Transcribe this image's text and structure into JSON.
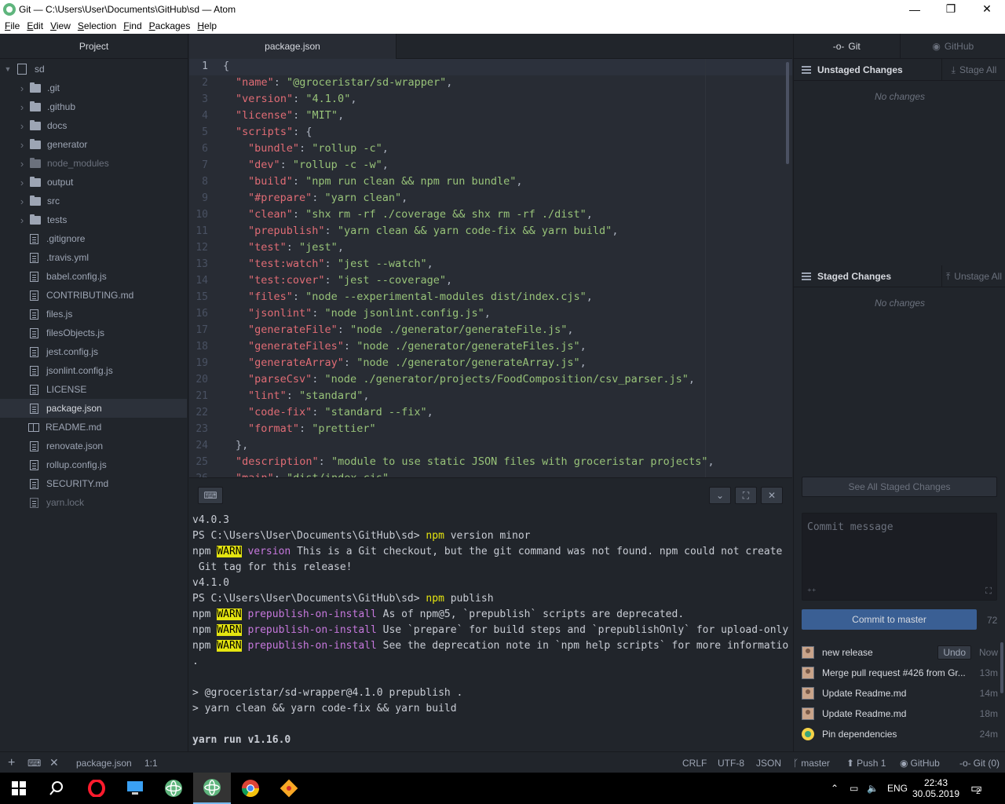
{
  "window": {
    "title": "Git — C:\\Users\\User\\Documents\\GitHub\\sd — Atom",
    "controls": [
      "—",
      "❐",
      "✕"
    ]
  },
  "menu": [
    {
      "u": "F",
      "rest": "ile"
    },
    {
      "u": "E",
      "rest": "dit"
    },
    {
      "u": "V",
      "rest": "iew"
    },
    {
      "u": "S",
      "rest": "election"
    },
    {
      "u": "F",
      "rest": "ind"
    },
    {
      "u": "P",
      "rest": "ackages"
    },
    {
      "u": "H",
      "rest": "elp"
    }
  ],
  "tree": {
    "title": "Project",
    "root": "sd",
    "items": [
      {
        "name": ".git",
        "type": "folder",
        "ignored": false
      },
      {
        "name": ".github",
        "type": "folder",
        "ignored": false
      },
      {
        "name": "docs",
        "type": "folder",
        "ignored": false
      },
      {
        "name": "generator",
        "type": "folder",
        "ignored": false
      },
      {
        "name": "node_modules",
        "type": "folder",
        "ignored": true
      },
      {
        "name": "output",
        "type": "folder",
        "ignored": false
      },
      {
        "name": "src",
        "type": "folder",
        "ignored": false
      },
      {
        "name": "tests",
        "type": "folder",
        "ignored": false
      },
      {
        "name": ".gitignore",
        "type": "file",
        "ignored": false
      },
      {
        "name": ".travis.yml",
        "type": "file",
        "ignored": false
      },
      {
        "name": "babel.config.js",
        "type": "file",
        "ignored": false
      },
      {
        "name": "CONTRIBUTING.md",
        "type": "file",
        "ignored": false
      },
      {
        "name": "files.js",
        "type": "file",
        "ignored": false
      },
      {
        "name": "filesObjects.js",
        "type": "file",
        "ignored": false
      },
      {
        "name": "jest.config.js",
        "type": "file",
        "ignored": false
      },
      {
        "name": "jsonlint.config.js",
        "type": "file",
        "ignored": false
      },
      {
        "name": "LICENSE",
        "type": "file",
        "ignored": false
      },
      {
        "name": "package.json",
        "type": "file",
        "ignored": false,
        "selected": true
      },
      {
        "name": "README.md",
        "type": "book",
        "ignored": false
      },
      {
        "name": "renovate.json",
        "type": "file",
        "ignored": false
      },
      {
        "name": "rollup.config.js",
        "type": "file",
        "ignored": false
      },
      {
        "name": "SECURITY.md",
        "type": "file",
        "ignored": false
      },
      {
        "name": "yarn.lock",
        "type": "file",
        "ignored": true
      }
    ]
  },
  "editor": {
    "tab": "package.json",
    "lines": [
      {
        "n": "1",
        "indent": 0,
        "text": "{"
      },
      {
        "n": "2",
        "indent": 1,
        "key": "\"name\"",
        "val": "\"@groceristar/sd-wrapper\"",
        "tail": ","
      },
      {
        "n": "3",
        "indent": 1,
        "key": "\"version\"",
        "val": "\"4.1.0\"",
        "tail": ","
      },
      {
        "n": "4",
        "indent": 1,
        "key": "\"license\"",
        "val": "\"MIT\"",
        "tail": ","
      },
      {
        "n": "5",
        "indent": 1,
        "key": "\"scripts\"",
        "val": "",
        "tail": " {"
      },
      {
        "n": "6",
        "indent": 2,
        "key": "\"bundle\"",
        "val": "\"rollup -c\"",
        "tail": ","
      },
      {
        "n": "7",
        "indent": 2,
        "key": "\"dev\"",
        "val": "\"rollup -c -w\"",
        "tail": ","
      },
      {
        "n": "8",
        "indent": 2,
        "key": "\"build\"",
        "val": "\"npm run clean && npm run bundle\"",
        "tail": ","
      },
      {
        "n": "9",
        "indent": 2,
        "key": "\"#prepare\"",
        "val": "\"yarn clean\"",
        "tail": ","
      },
      {
        "n": "10",
        "indent": 2,
        "key": "\"clean\"",
        "val": "\"shx rm -rf ./coverage && shx rm -rf ./dist\"",
        "tail": ","
      },
      {
        "n": "11",
        "indent": 2,
        "key": "\"prepublish\"",
        "val": "\"yarn clean && yarn code-fix && yarn build\"",
        "tail": ","
      },
      {
        "n": "12",
        "indent": 2,
        "key": "\"test\"",
        "val": "\"jest\"",
        "tail": ","
      },
      {
        "n": "13",
        "indent": 2,
        "key": "\"test:watch\"",
        "val": "\"jest --watch\"",
        "tail": ","
      },
      {
        "n": "14",
        "indent": 2,
        "key": "\"test:cover\"",
        "val": "\"jest --coverage\"",
        "tail": ","
      },
      {
        "n": "15",
        "indent": 2,
        "key": "\"files\"",
        "val": "\"node --experimental-modules dist/index.cjs\"",
        "tail": ","
      },
      {
        "n": "16",
        "indent": 2,
        "key": "\"jsonlint\"",
        "val": "\"node jsonlint.config.js\"",
        "tail": ","
      },
      {
        "n": "17",
        "indent": 2,
        "key": "\"generateFile\"",
        "val": "\"node ./generator/generateFile.js\"",
        "tail": ","
      },
      {
        "n": "18",
        "indent": 2,
        "key": "\"generateFiles\"",
        "val": "\"node ./generator/generateFiles.js\"",
        "tail": ","
      },
      {
        "n": "19",
        "indent": 2,
        "key": "\"generateArray\"",
        "val": "\"node ./generator/generateArray.js\"",
        "tail": ","
      },
      {
        "n": "20",
        "indent": 2,
        "key": "\"parseCsv\"",
        "val": "\"node ./generator/projects/FoodComposition/csv_parser.js\"",
        "tail": ","
      },
      {
        "n": "21",
        "indent": 2,
        "key": "\"lint\"",
        "val": "\"standard\"",
        "tail": ","
      },
      {
        "n": "22",
        "indent": 2,
        "key": "\"code-fix\"",
        "val": "\"standard --fix\"",
        "tail": ","
      },
      {
        "n": "23",
        "indent": 2,
        "key": "\"format\"",
        "val": "\"prettier\"",
        "tail": ""
      },
      {
        "n": "24",
        "indent": 1,
        "text": "},"
      },
      {
        "n": "25",
        "indent": 1,
        "key": "\"description\"",
        "val": "\"module to use static JSON files with groceristar projects\"",
        "tail": ","
      },
      {
        "n": "26",
        "indent": 1,
        "key": "\"main\"",
        "val": "\"dist/index.cjs\"",
        "tail": ","
      }
    ]
  },
  "terminal": {
    "lines": [
      [
        {
          "t": "v4.0.3"
        }
      ],
      [
        {
          "t": "PS C:\\Users\\User\\Documents\\GitHub\\sd> "
        },
        {
          "t": "npm",
          "c": "cmd"
        },
        {
          "t": " version minor"
        }
      ],
      [
        {
          "t": "npm "
        },
        {
          "t": "WARN",
          "c": "warn"
        },
        {
          "t": " "
        },
        {
          "t": "version",
          "c": "mag"
        },
        {
          "t": " This is a Git checkout, but the git command was not found. npm could not create a"
        }
      ],
      [
        {
          "t": " Git tag for this release!"
        }
      ],
      [
        {
          "t": "v4.1.0"
        }
      ],
      [
        {
          "t": "PS C:\\Users\\User\\Documents\\GitHub\\sd> "
        },
        {
          "t": "npm",
          "c": "cmd"
        },
        {
          "t": " publish"
        }
      ],
      [
        {
          "t": "npm "
        },
        {
          "t": "WARN",
          "c": "warn"
        },
        {
          "t": " "
        },
        {
          "t": "prepublish-on-install",
          "c": "mag"
        },
        {
          "t": " As of npm@5, `prepublish` scripts are deprecated."
        }
      ],
      [
        {
          "t": "npm "
        },
        {
          "t": "WARN",
          "c": "warn"
        },
        {
          "t": " "
        },
        {
          "t": "prepublish-on-install",
          "c": "mag"
        },
        {
          "t": " Use `prepare` for build steps and `prepublishOnly` for upload-only."
        }
      ],
      [
        {
          "t": "npm "
        },
        {
          "t": "WARN",
          "c": "warn"
        },
        {
          "t": " "
        },
        {
          "t": "prepublish-on-install",
          "c": "mag"
        },
        {
          "t": " See the deprecation note in `npm help scripts` for more information"
        }
      ],
      [
        {
          "t": "."
        }
      ],
      [
        {
          "t": ""
        }
      ],
      [
        {
          "t": "> @groceristar/sd-wrapper@4.1.0 prepublish ."
        }
      ],
      [
        {
          "t": "> yarn clean && yarn code-fix && yarn build"
        }
      ],
      [
        {
          "t": ""
        }
      ],
      [
        {
          "t": "yarn run v1.16.0",
          "c": "bold"
        }
      ]
    ]
  },
  "git": {
    "tab_git": "Git",
    "tab_github": "GitHub",
    "unstaged_title": "Unstaged Changes",
    "stage_all": "Stage All",
    "staged_title": "Staged Changes",
    "unstage_all": "Unstage All",
    "no_changes": "No changes",
    "see_all": "See All Staged Changes",
    "commit_placeholder": "Commit message",
    "commit_button": "Commit to master",
    "char_count": "72",
    "undo": "Undo",
    "commits": [
      {
        "msg": "new release",
        "time": "Now",
        "undo": true,
        "bot": false
      },
      {
        "msg": "Merge pull request #426 from Gr...",
        "time": "13m",
        "undo": false,
        "bot": false
      },
      {
        "msg": "Update Readme.md",
        "time": "14m",
        "undo": false,
        "bot": false
      },
      {
        "msg": "Update Readme.md",
        "time": "18m",
        "undo": false,
        "bot": false
      },
      {
        "msg": "Pin dependencies",
        "time": "24m",
        "undo": false,
        "bot": true
      }
    ]
  },
  "status": {
    "file": "package.json",
    "cursor": "1:1",
    "eol": "CRLF",
    "encoding": "UTF-8",
    "grammar": "JSON",
    "branch": "master",
    "push": "Push 1",
    "github": "GitHub",
    "git": "Git (0)"
  },
  "taskbar": {
    "lang": "ENG",
    "time": "22:43",
    "date": "30.05.2019",
    "notifications": "2"
  }
}
